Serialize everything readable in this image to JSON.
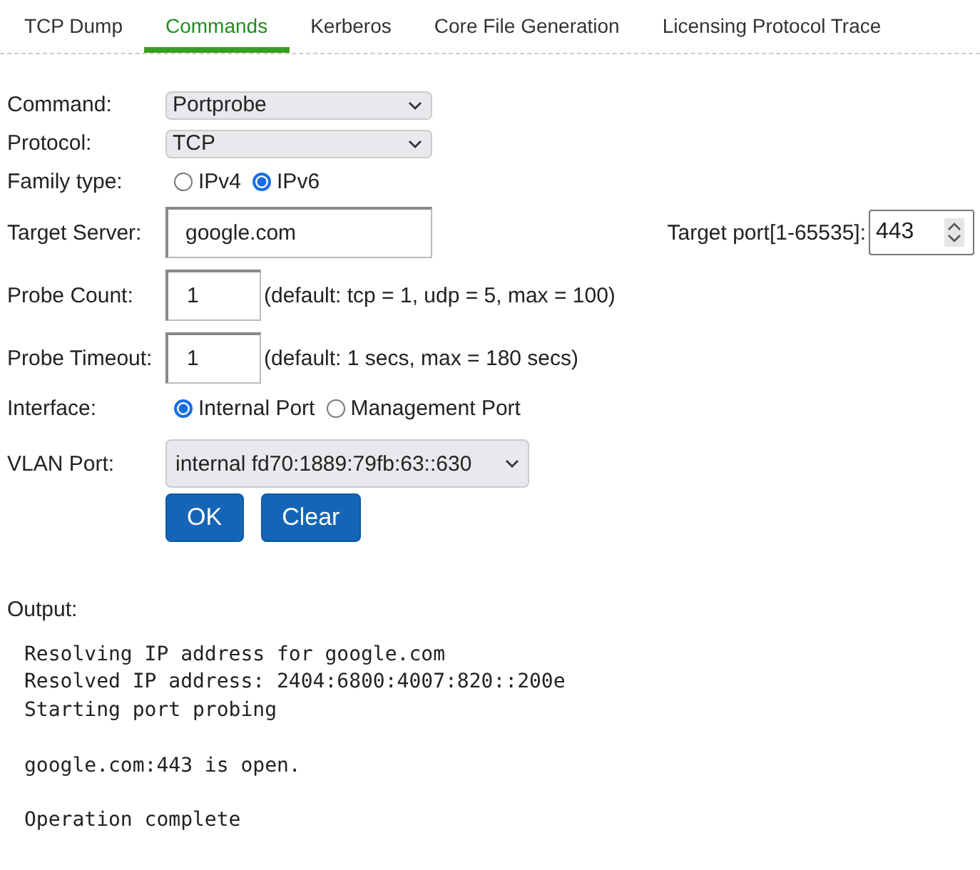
{
  "tabs": [
    {
      "label": "TCP Dump",
      "selected": false
    },
    {
      "label": "Commands",
      "selected": true
    },
    {
      "label": "Kerberos",
      "selected": false
    },
    {
      "label": "Core File Generation",
      "selected": false
    },
    {
      "label": "Licensing Protocol Trace",
      "selected": false
    }
  ],
  "form": [
    {
      "kind": "select",
      "label": "Command:",
      "value": "Portprobe"
    },
    {
      "kind": "select",
      "label": "Protocol:",
      "value": "TCP"
    },
    {
      "kind": "radio",
      "label": "Family type:",
      "options": [
        {
          "label": "IPv4",
          "selected": false
        },
        {
          "label": "IPv6",
          "selected": true
        }
      ]
    },
    {
      "kind": "server",
      "label": "Target Server:",
      "value": "google.com",
      "port_label": "Target port[1-65535]:",
      "port_value": "443"
    },
    {
      "kind": "count",
      "label": "Probe Count:",
      "value": "1",
      "hint": "(default: tcp = 1, udp = 5, max = 100)"
    },
    {
      "kind": "count",
      "label": "Probe Timeout:",
      "value": "1",
      "hint": "(default: 1 secs, max = 180 secs)"
    },
    {
      "kind": "radio",
      "label": "Interface:",
      "options": [
        {
          "label": "Internal Port",
          "selected": true
        },
        {
          "label": "Management Port",
          "selected": false
        }
      ]
    },
    {
      "kind": "wideselect",
      "label": "VLAN Port:",
      "value": "internal fd70:1889:79fb:63::630"
    }
  ],
  "buttons": [
    "OK",
    "Clear"
  ],
  "output_label": "Output:",
  "output": "Resolving IP address for google.com\nResolved IP address: 2404:6800:4007:820::200e\nStarting port probing\n\ngoogle.com:443 is open.\n\nOperation complete"
}
